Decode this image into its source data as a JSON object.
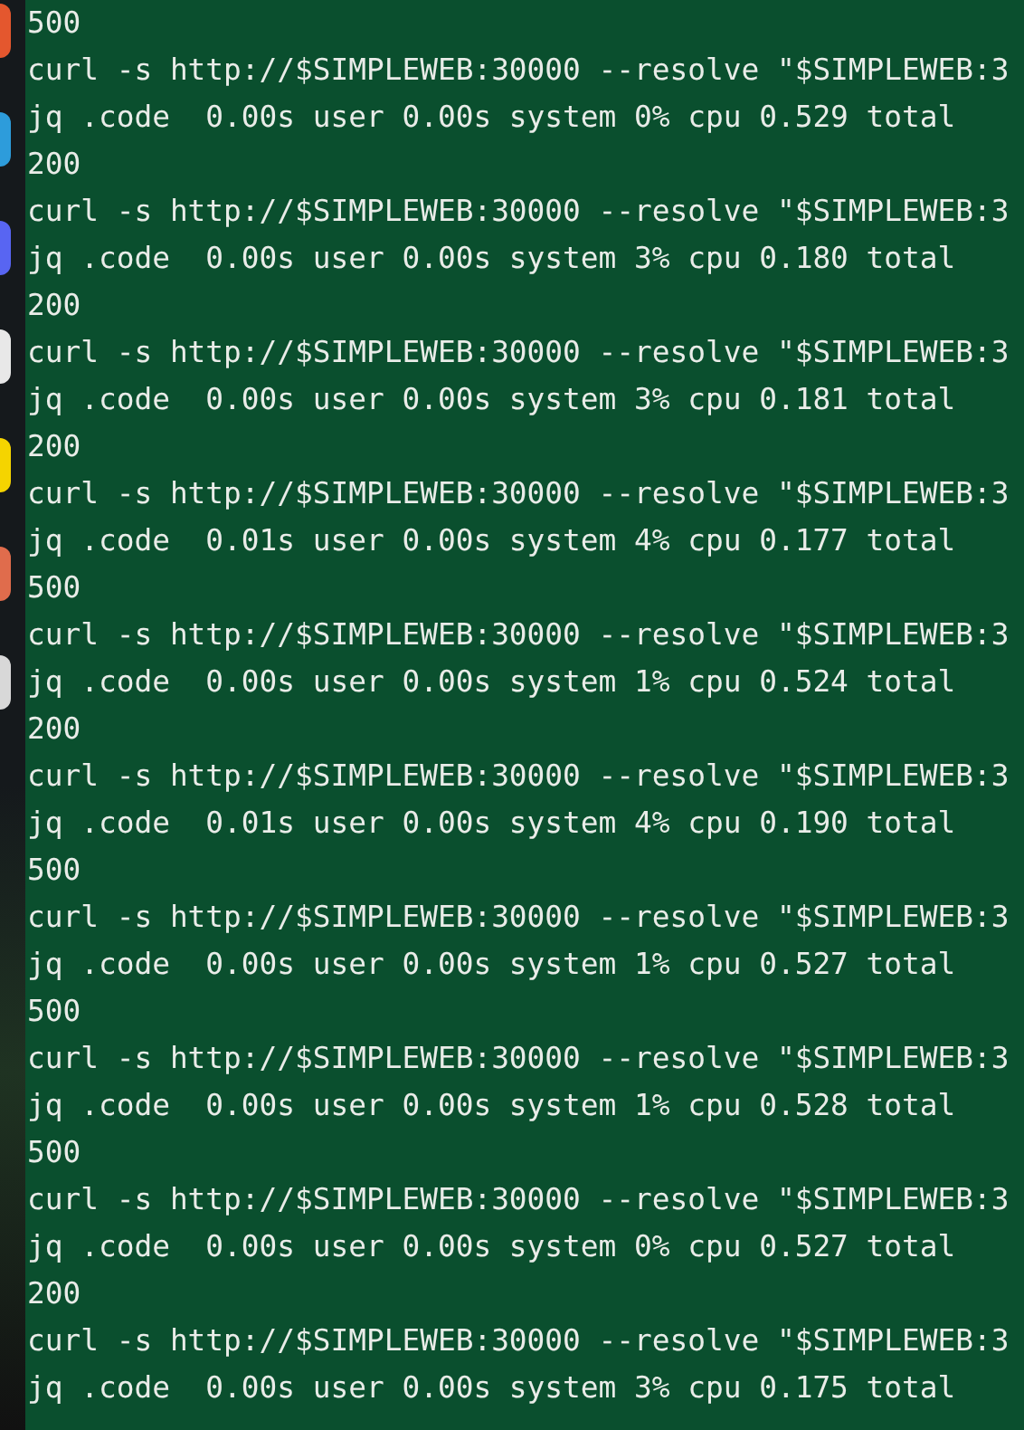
{
  "dock": [
    {
      "color": "#e4572e"
    },
    {
      "color": "#2d9cdb"
    },
    {
      "color": "#5865f2"
    },
    {
      "color": "#e8e8e8"
    },
    {
      "color": "#f5d400"
    },
    {
      "color": "#e06c4c"
    },
    {
      "color": "#d8d8d8"
    }
  ],
  "terminal": {
    "lines": [
      "500",
      "curl -s http://$SIMPLEWEB:30000 --resolve \"$SIMPLEWEB:3",
      "jq .code  0.00s user 0.00s system 0% cpu 0.529 total",
      "200",
      "curl -s http://$SIMPLEWEB:30000 --resolve \"$SIMPLEWEB:3",
      "jq .code  0.00s user 0.00s system 3% cpu 0.180 total",
      "200",
      "curl -s http://$SIMPLEWEB:30000 --resolve \"$SIMPLEWEB:3",
      "jq .code  0.00s user 0.00s system 3% cpu 0.181 total",
      "200",
      "curl -s http://$SIMPLEWEB:30000 --resolve \"$SIMPLEWEB:3",
      "jq .code  0.01s user 0.00s system 4% cpu 0.177 total",
      "500",
      "curl -s http://$SIMPLEWEB:30000 --resolve \"$SIMPLEWEB:3",
      "jq .code  0.00s user 0.00s system 1% cpu 0.524 total",
      "200",
      "curl -s http://$SIMPLEWEB:30000 --resolve \"$SIMPLEWEB:3",
      "jq .code  0.01s user 0.00s system 4% cpu 0.190 total",
      "500",
      "curl -s http://$SIMPLEWEB:30000 --resolve \"$SIMPLEWEB:3",
      "jq .code  0.00s user 0.00s system 1% cpu 0.527 total",
      "500",
      "curl -s http://$SIMPLEWEB:30000 --resolve \"$SIMPLEWEB:3",
      "jq .code  0.00s user 0.00s system 1% cpu 0.528 total",
      "500",
      "curl -s http://$SIMPLEWEB:30000 --resolve \"$SIMPLEWEB:3",
      "jq .code  0.00s user 0.00s system 0% cpu 0.527 total",
      "200",
      "curl -s http://$SIMPLEWEB:30000 --resolve \"$SIMPLEWEB:3",
      "jq .code  0.00s user 0.00s system 3% cpu 0.175 total"
    ]
  }
}
